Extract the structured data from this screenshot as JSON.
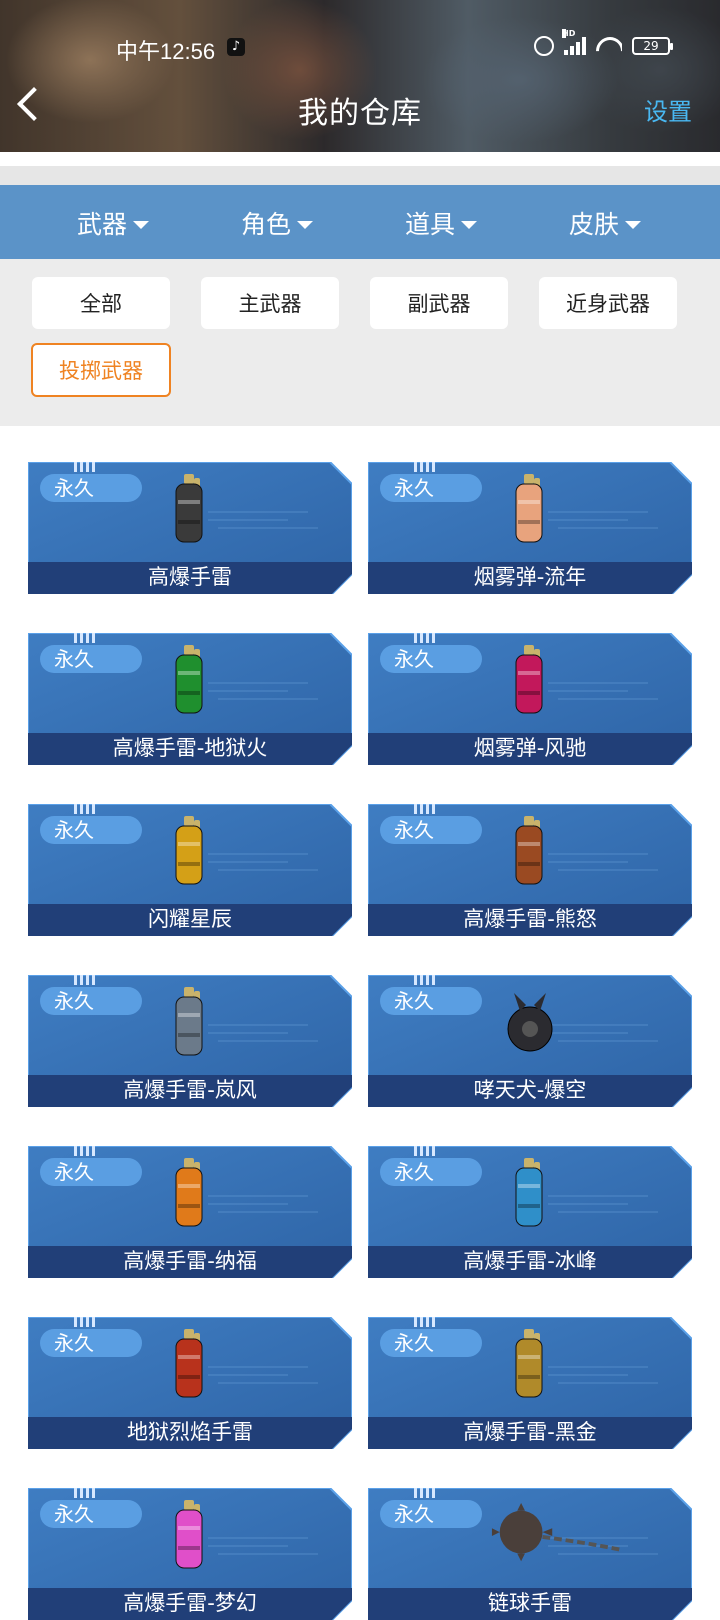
{
  "status_bar": {
    "time": "中午12:56",
    "battery": "29",
    "signal_label": "HD"
  },
  "header": {
    "title": "我的仓库",
    "settings": "设置"
  },
  "categories": [
    {
      "label": "武器",
      "active": true
    },
    {
      "label": "角色",
      "active": false
    },
    {
      "label": "道具",
      "active": false
    },
    {
      "label": "皮肤",
      "active": false
    }
  ],
  "subtypes": [
    {
      "label": "全部",
      "active": false
    },
    {
      "label": "主武器",
      "active": false
    },
    {
      "label": "副武器",
      "active": false
    },
    {
      "label": "近身武器",
      "active": false
    },
    {
      "label": "投掷武器",
      "active": true
    }
  ],
  "items": [
    {
      "badge": "永久",
      "name": "高爆手雷",
      "icon": "grenade-icon",
      "color": "#3a3a3a"
    },
    {
      "badge": "永久",
      "name": "烟雾弹-流年",
      "icon": "smoke-grenade-icon",
      "color": "#e8a37d"
    },
    {
      "badge": "永久",
      "name": "高爆手雷-地狱火",
      "icon": "grenade-icon",
      "color": "#1f8f2e"
    },
    {
      "badge": "永久",
      "name": "烟雾弹-风驰",
      "icon": "smoke-grenade-icon",
      "color": "#c2185b"
    },
    {
      "badge": "永久",
      "name": "闪耀星辰",
      "icon": "flash-grenade-icon",
      "color": "#d4a017"
    },
    {
      "badge": "永久",
      "name": "高爆手雷-熊怒",
      "icon": "grenade-icon",
      "color": "#9a4a22"
    },
    {
      "badge": "永久",
      "name": "高爆手雷-岚风",
      "icon": "grenade-icon",
      "color": "#6b7a8a"
    },
    {
      "badge": "永久",
      "name": "哮天犬-爆空",
      "icon": "dog-bomb-icon",
      "color": "#2b2b30"
    },
    {
      "badge": "永久",
      "name": "高爆手雷-纳福",
      "icon": "grenade-icon",
      "color": "#e07a1a"
    },
    {
      "badge": "永久",
      "name": "高爆手雷-冰峰",
      "icon": "grenade-icon",
      "color": "#2f8fc9"
    },
    {
      "badge": "永久",
      "name": "地狱烈焰手雷",
      "icon": "fire-grenade-icon",
      "color": "#b8321c"
    },
    {
      "badge": "永久",
      "name": "高爆手雷-黑金",
      "icon": "grenade-icon",
      "color": "#b08a2a"
    },
    {
      "badge": "永久",
      "name": "高爆手雷-梦幻",
      "icon": "grenade-icon",
      "color": "#e04fc9"
    },
    {
      "badge": "永久",
      "name": "链球手雷",
      "icon": "chain-ball-icon",
      "color": "#4a3f3a"
    }
  ]
}
